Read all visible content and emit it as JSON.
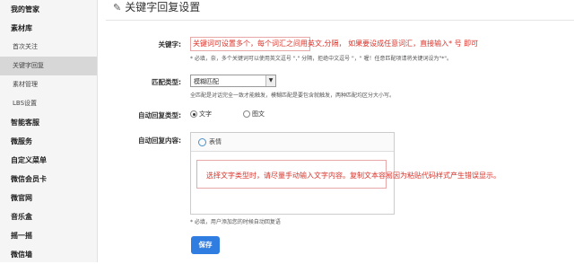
{
  "sidebar": {
    "items": [
      {
        "label": "我的管家",
        "kind": "group"
      },
      {
        "label": "素材库",
        "kind": "group"
      },
      {
        "label": "首次关注",
        "kind": "sub"
      },
      {
        "label": "关键字回复",
        "kind": "sub",
        "active": true
      },
      {
        "label": "素材管理",
        "kind": "sub"
      },
      {
        "label": "LBS设置",
        "kind": "sub"
      },
      {
        "label": "智能客服",
        "kind": "group"
      },
      {
        "label": "微服务",
        "kind": "group"
      },
      {
        "label": "自定义菜单",
        "kind": "group"
      },
      {
        "label": "微信会员卡",
        "kind": "group"
      },
      {
        "label": "微官网",
        "kind": "group"
      },
      {
        "label": "音乐盒",
        "kind": "group"
      },
      {
        "label": "摇一摇",
        "kind": "group"
      },
      {
        "label": "微信墙",
        "kind": "group"
      }
    ]
  },
  "main": {
    "title": "关键字回复设置",
    "keyword": {
      "label": "关键字:",
      "value": "关键词可设置多个，每个词汇之间用英文,分隔， 如果要设成任意词汇，直接输入* 号 即可",
      "hint": "* 必填，奈，多个关键词可以使用英文逗号 \",\" 分隔，拒绝中文逗号 \"，\" 喔！任意匹配项请将关键词设为\"*\"。"
    },
    "match_type": {
      "label": "匹配类型:",
      "selected": "模糊匹配",
      "hint": "全匹配是对话完全一致才能触发，模糊匹配是要包含就触发，两种匹配均区分大小写。"
    },
    "reply_type": {
      "label": "自动回复类型:",
      "options": [
        {
          "label": "文字",
          "checked": true
        },
        {
          "label": "图文",
          "checked": false
        }
      ]
    },
    "reply_content": {
      "label": "自动回复内容:",
      "toolbar_emoji": "表情",
      "note": "选择文字类型时，请尽量手动输入文字内容。复制文本容易因为粘贴代码样式产生错误显示。",
      "hint": "* 必填，用户添加您的时候自动回复语"
    },
    "save_label": "保存"
  },
  "colors": {
    "accent": "#2f7de1",
    "annotation": "#d9342b",
    "sidebar_bg": "#f5f5f5",
    "sidebar_active": "#d7d7d7"
  }
}
